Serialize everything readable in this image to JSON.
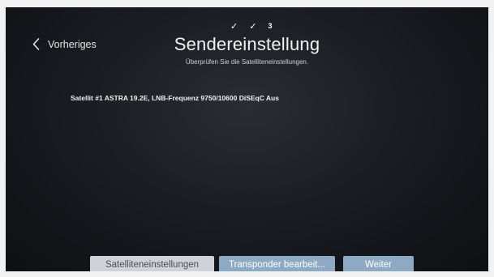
{
  "progress": {
    "completed_marks": [
      "✓",
      "✓"
    ],
    "current_step": "3"
  },
  "nav": {
    "back_label": "Vorheriges"
  },
  "header": {
    "title": "Sendereinstellung",
    "subtitle": "Überprüfen Sie die Satelliteneinstellungen."
  },
  "satellite": {
    "summary": "Satellit #1 ASTRA 19.2E, LNB-Frequenz 9750/10600 DiSEqC Aus"
  },
  "buttons": {
    "satellite_settings": "Satelliteneinstellungen",
    "transponder_edit": "Transponder bearbeit...",
    "next": "Weiter"
  },
  "colors": {
    "screen_background": "#15181c",
    "button_selected": "#cfd3d8",
    "button_default": "#8ea9c3"
  }
}
